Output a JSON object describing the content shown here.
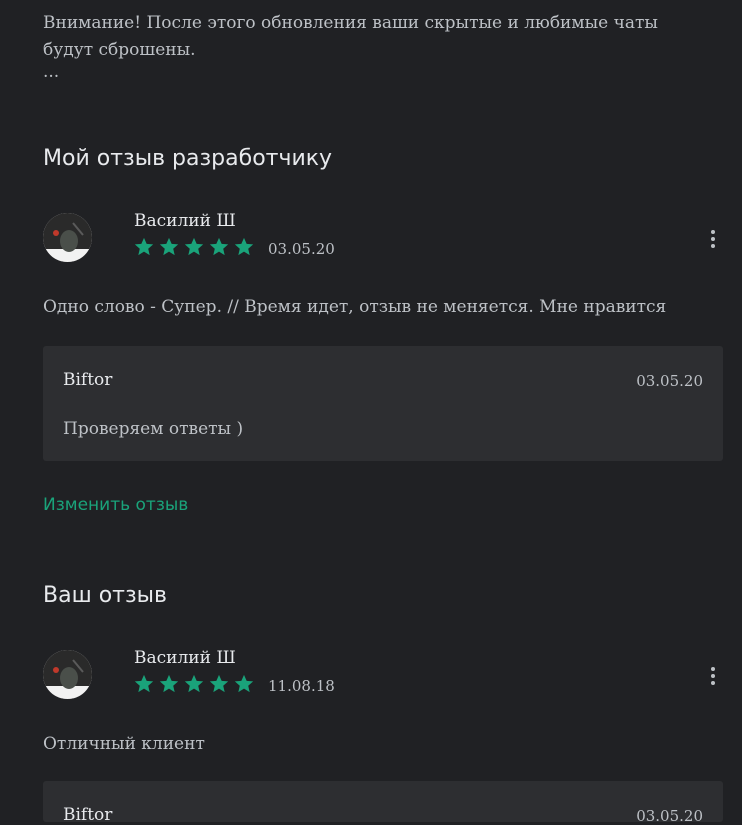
{
  "notice": {
    "text": "Внимание! После этого обновления ваши скрытые и любимые чаты будут сброшены.",
    "ellipsis": "..."
  },
  "my_review_section": {
    "title": "Мой отзыв разработчику",
    "review": {
      "author": "Василий Ш",
      "rating": 5,
      "date": "03.05.20",
      "text": "Одно слово - Супер. // Время идет, отзыв не меняется. Мне нравится"
    },
    "reply": {
      "author": "Biftor",
      "date": "03.05.20",
      "text": "Проверяем ответы )"
    },
    "edit_label": "Изменить отзыв"
  },
  "your_review_section": {
    "title": "Ваш отзыв",
    "review": {
      "author": "Василий Ш",
      "rating": 5,
      "date": "11.08.18",
      "text": "Отличный клиент"
    },
    "reply": {
      "author": "Biftor",
      "date": "03.05.20"
    }
  },
  "colors": {
    "background": "#202124",
    "accent": "#1aa37a",
    "reply_background": "#2d2e31"
  },
  "icons": {
    "star": "star-icon",
    "menu": "more-vert-icon"
  }
}
